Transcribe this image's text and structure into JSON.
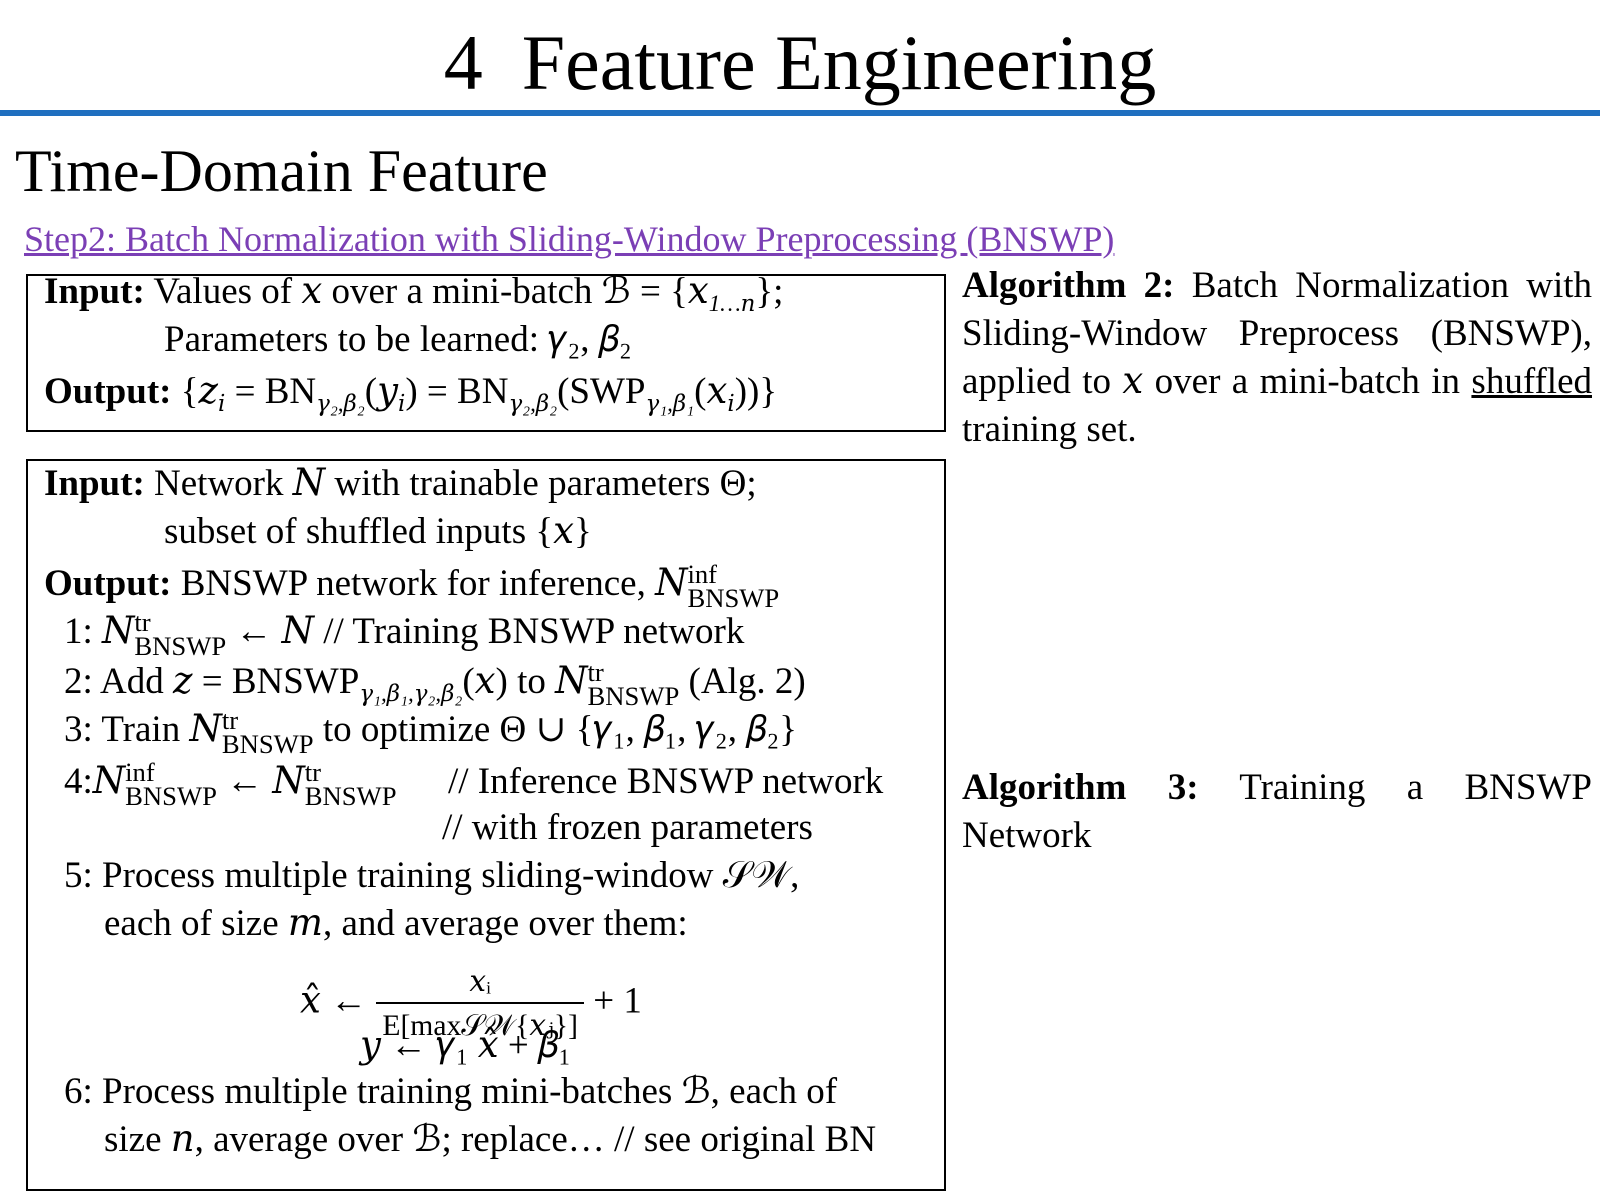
{
  "title": "4  Feature Engineering",
  "subtitle": "Time-Domain Feature",
  "step_link": "Step2: Batch Normalization with Sliding-Window Preprocessing (BNSWP)",
  "colors": {
    "rule": "#1f6fbf",
    "link": "#7b3fb5"
  },
  "alg2_box": {
    "input_label": "Input:",
    "input_text": "Values of 𝑥 over a mini-batch ℬ = {𝑥",
    "input_sub": "1…𝑛",
    "input_end": "};",
    "params_text": "Parameters to be learned: 𝛾₂, 𝛽₂",
    "output_label": "Output:",
    "output_text_1": "{𝑧",
    "output_sub_i": "𝑖",
    "output_text_2": " = BN",
    "output_sub_bn": "𝛾₂,𝛽₂",
    "output_text_3": "(𝑦",
    "output_text_4": ") = BN",
    "output_text_5": "(SWP",
    "output_sub_swp": "𝛾₁,𝛽₁",
    "output_text_6": "(𝑥",
    "output_text_7": "))}"
  },
  "alg2_caption": {
    "label": "Algorithm 2:",
    "text_1": "Batch Normalization with Sliding-Window Preprocess (BNSWP), applied to 𝑥 over a mini-batch in ",
    "underlined": "shuffled",
    "text_2": " training set."
  },
  "alg3_box": {
    "input_label": "Input:",
    "input_text": "Network 𝑁 with trainable parameters Θ;",
    "input_line2": "subset of shuffled inputs {𝑥}",
    "output_label": "Output:",
    "output_text": "BNSWP network for inference, 𝑁",
    "sup_inf": "inf",
    "sub_bnswp": "BNSWP",
    "sup_tr": "tr",
    "step1_num": "1:",
    "step1_text": " ← 𝑁   // Training BNSWP network",
    "step2_num": "2:",
    "step2_a": "Add 𝑧 = BNSWP",
    "step2_sub": "𝛾₁,𝛽₁,𝛾₂,𝛽₂",
    "step2_b": "(𝑥) to ",
    "step2_c": " (Alg. 2)",
    "step3_num": "3:",
    "step3_a": "Train ",
    "step3_b": " to optimize Θ ∪ {𝛾₁, 𝛽₁, 𝛾₂, 𝛽₂}",
    "step4_num": "4:",
    "step4_arrow": " ← ",
    "step4_comment": "// Inference BNSWP network",
    "step4_comment2": "// with frozen parameters",
    "step5_num": "5:",
    "step5_text": "Process multiple training sliding-window 𝒮𝒲,",
    "step5_line2": "each of size 𝑚, and average over them:",
    "eq1_lhs": "𝑥̂ ←",
    "eq1_num": "𝑥ᵢ",
    "eq1_den": "E[max𝒮𝒲{𝑥ⱼ}]",
    "eq1_tail": "+ 1",
    "eq2": "𝑦 ← 𝛾₁ 𝑥̂ + 𝛽₁",
    "step6_num": "6:",
    "step6_text": "Process multiple training mini-batches ℬ, each of",
    "step6_line2": "size 𝑛, average over ℬ; replace… // see original BN"
  },
  "alg3_caption": {
    "label": "Algorithm 3:",
    "text": "Training a BNSWP Network"
  }
}
